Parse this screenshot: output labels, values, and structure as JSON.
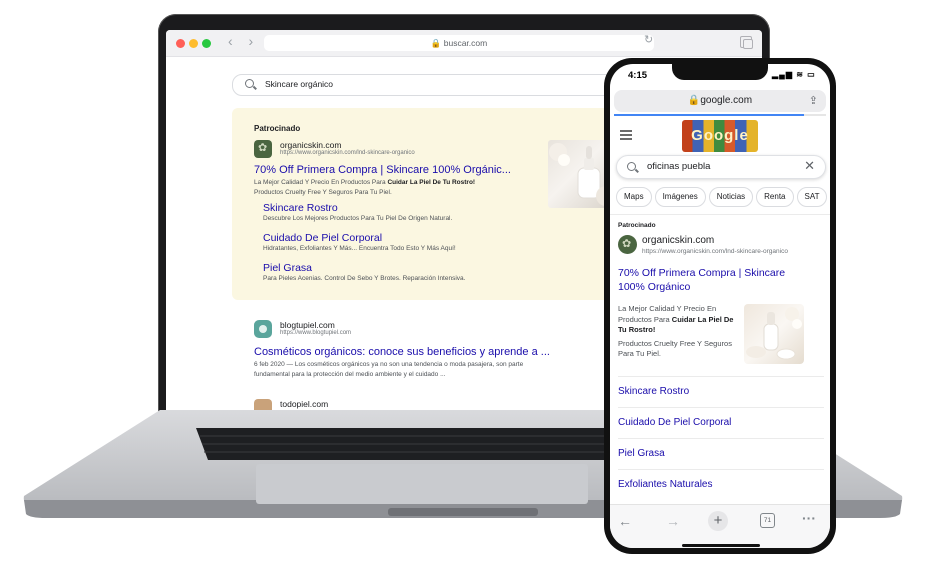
{
  "laptop": {
    "url": "buscar.com",
    "search_query": "Skincare orgánico",
    "ad": {
      "sponsored_label": "Patrocinado",
      "site_name": "organicskin.com",
      "site_url": "https://www.organicskin.com/lnd-skincare-organico",
      "title": "70% Off Primera Compra | Skincare 100% Orgánic...",
      "desc_line1_pre": "La Mejor Calidad Y Precio En Productos Para ",
      "desc_line1_bold": "Cuidar La Piel De Tu Rostro!",
      "desc_line2": "Productos Cruelty Free Y Seguros Para Tu Piel.",
      "sitelinks": [
        {
          "title": "Skincare Rostro",
          "desc": "Descubre Los Mejores Productos Para Tu Piel De Origen Natural."
        },
        {
          "title": "Cuidado De Piel Corporal",
          "desc": "Hidratantes, Exfoliantes Y Más... Encuentra Todo Esto Y Más Aquí!"
        },
        {
          "title": "Piel Grasa",
          "desc": "Para Pieles Acenias. Control De Sebo Y Brotes. Reparación Intensiva."
        }
      ]
    },
    "organic": {
      "site_name": "blogtupiel.com",
      "site_url": "https://www.blogtupiel.com",
      "title": "Cosméticos orgánicos: conoce sus beneficios y aprende a ...",
      "snippet_line1": "6 feb 2020 — Los cosméticos orgánicos ya no son una tendencia o moda pasajera, son parte",
      "snippet_line2": "fundamental para la protección del medio ambiente y el cuidado ..."
    },
    "next_result_site": "todopiel.com"
  },
  "phone": {
    "time": "4:15",
    "url": "google.com",
    "doodle_text": "Google",
    "search_query": "oficinas puebla",
    "chips": [
      "Maps",
      "Imágenes",
      "Noticias",
      "Renta",
      "SAT"
    ],
    "ad": {
      "sponsored_label": "Patrocinado",
      "site_name": "organicskin.com",
      "site_url": "https://www.organicskin.com/lnd-skincare-organico",
      "title": "70% Off Primera Compra | Skincare 100% Orgánico",
      "desc_pre": "La Mejor Calidad Y Precio En Productos Para ",
      "desc_bold": "Cuidar La Piel De Tu Rostro!",
      "desc_line2": "Productos Cruelty Free Y Seguros Para Tu Piel."
    },
    "sitelinks": [
      "Skincare Rostro",
      "Cuidado De Piel Corporal",
      "Piel Grasa",
      "Exfoliantes Naturales"
    ],
    "tab_count": "71"
  },
  "colors": {
    "link_blue": "#1a0dab",
    "ad_background": "#fbf7e1",
    "brand_green": "#4a6540"
  }
}
